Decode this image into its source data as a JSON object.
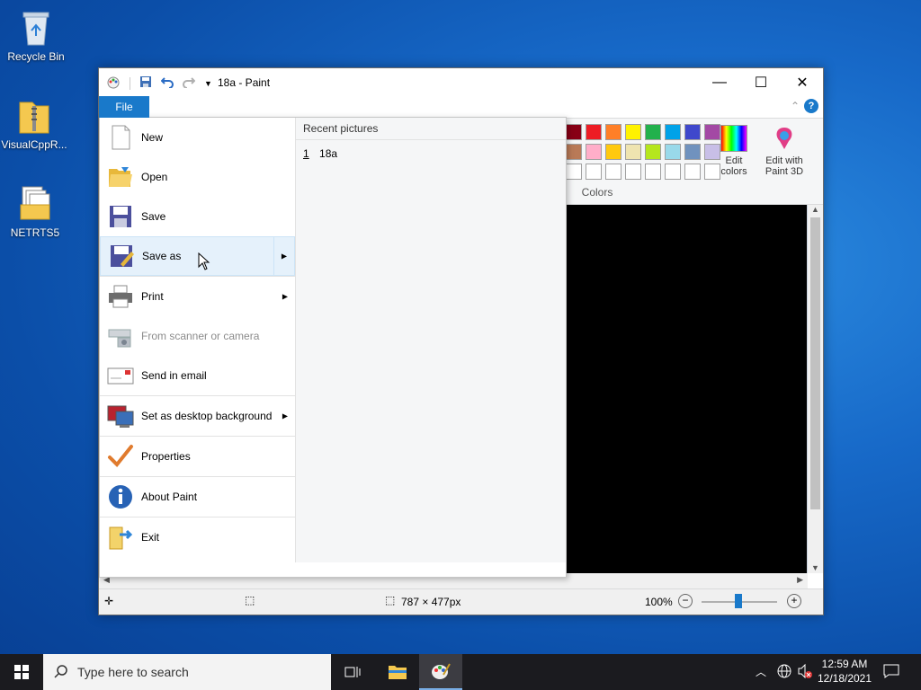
{
  "desktop": {
    "icons": [
      {
        "label": "Recycle Bin"
      },
      {
        "label": "VisualCppR..."
      },
      {
        "label": "NETRTS5"
      }
    ]
  },
  "window": {
    "title": "18a - Paint",
    "ribbon": {
      "colors_group_label": "Colors",
      "edit_colors_label": "Edit colors",
      "edit_with_paint3d_label": "Edit with Paint 3D",
      "palette_row1": [
        "#880015",
        "#ed1c24",
        "#ff7f27",
        "#fff200",
        "#22b14c",
        "#00a2e8",
        "#3f48cc",
        "#a349a4"
      ],
      "palette_row2": [
        "#b97a57",
        "#ffaec9",
        "#ffc90e",
        "#efe4b0",
        "#b5e61d",
        "#99d9ea",
        "#7092be",
        "#c8bfe7"
      ]
    },
    "status": {
      "dimensions": "787 × 477px",
      "zoom": "100%"
    }
  },
  "file_menu": {
    "tab_label": "File",
    "items": [
      {
        "label": "New",
        "icon": "new-document-icon"
      },
      {
        "label": "Open",
        "icon": "open-folder-icon"
      },
      {
        "label": "Save",
        "icon": "floppy-disk-icon"
      },
      {
        "label": "Save as",
        "icon": "save-as-icon"
      },
      {
        "label": "Print",
        "icon": "printer-icon"
      },
      {
        "label": "From scanner or camera",
        "icon": "scanner-icon"
      },
      {
        "label": "Send in email",
        "icon": "email-icon"
      },
      {
        "label": "Set as desktop background",
        "icon": "desktop-background-icon"
      },
      {
        "label": "Properties",
        "icon": "checkmark-icon"
      },
      {
        "label": "About Paint",
        "icon": "info-icon"
      },
      {
        "label": "Exit",
        "icon": "exit-icon"
      }
    ],
    "recent": {
      "header": "Recent pictures",
      "items": [
        {
          "num": "1",
          "name": "18a"
        }
      ]
    }
  },
  "taskbar": {
    "search_placeholder": "Type here to search",
    "time": "12:59 AM",
    "date": "12/18/2021"
  }
}
